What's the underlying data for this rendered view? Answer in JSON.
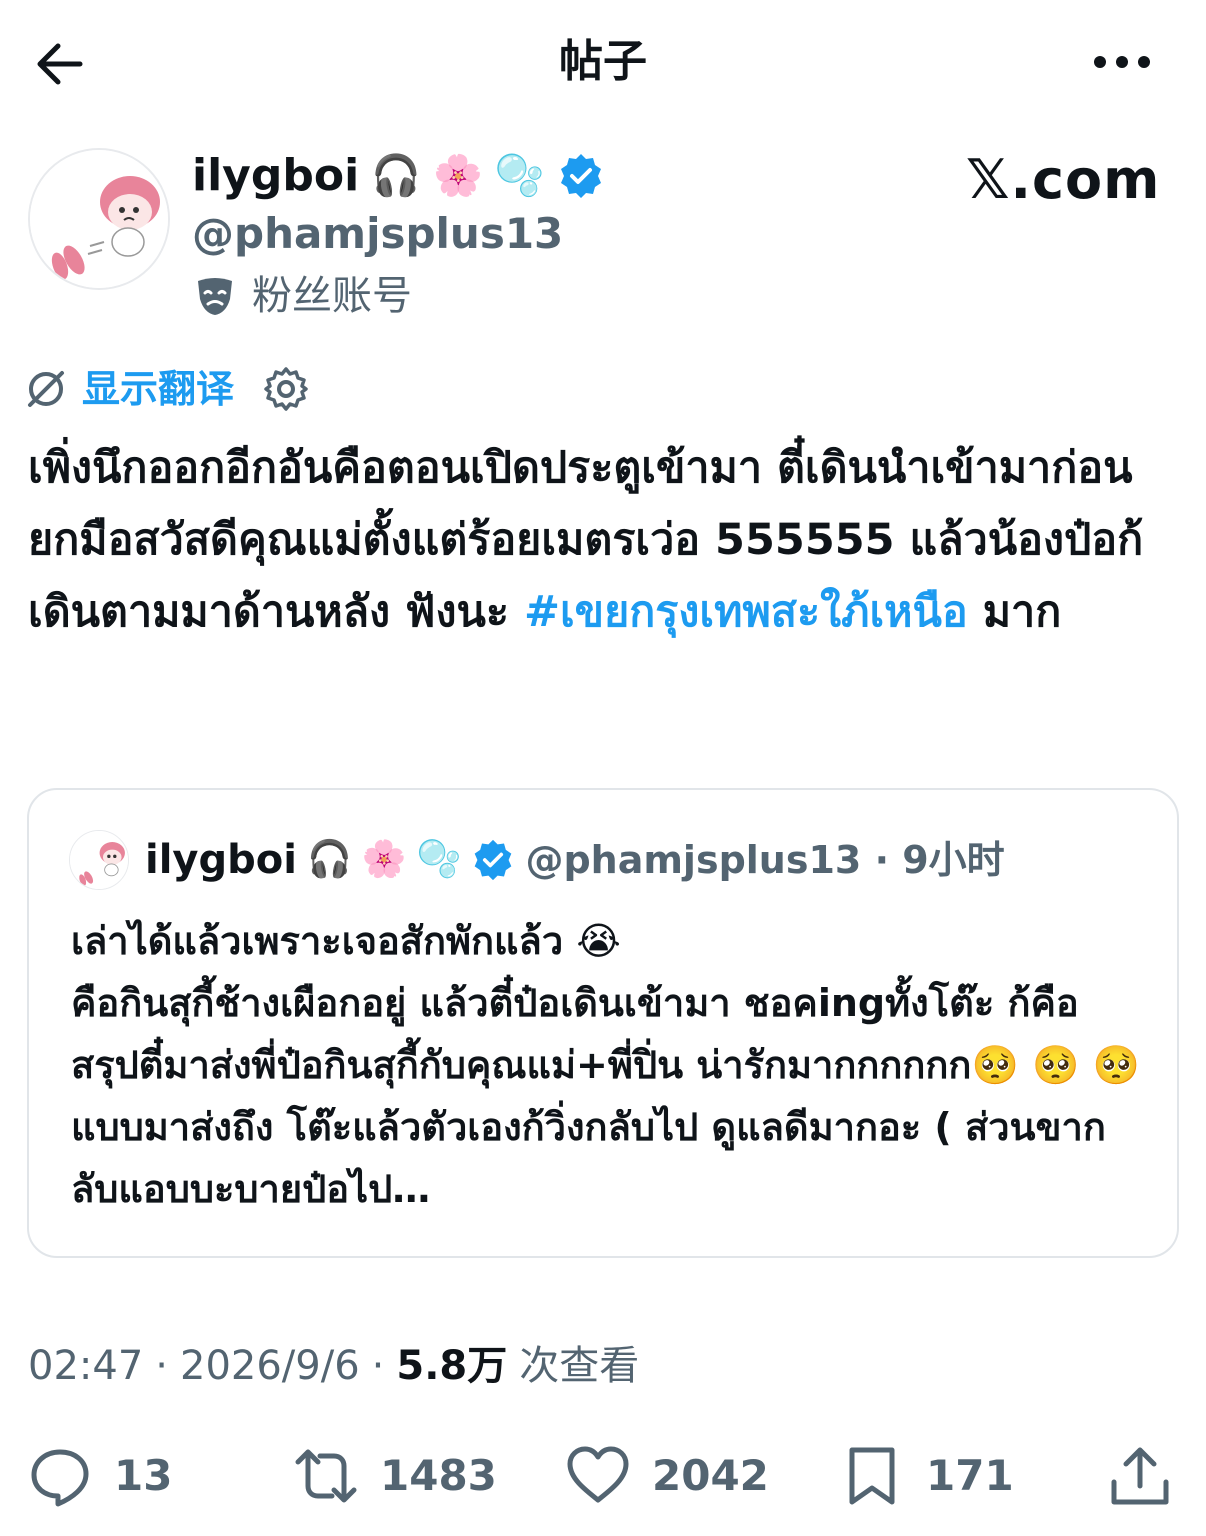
{
  "topbar": {
    "title": "帖子",
    "back_icon": "arrow-left-icon",
    "more_icon": "more-horizontal-icon"
  },
  "author": {
    "name": "ilygboi",
    "emojis": [
      "🎧",
      "🌸",
      "🫧"
    ],
    "handle": "@phamjsplus13",
    "fan_label": "粉丝账号",
    "brand": "𝕏.com",
    "verified_color": "#1d9bf0"
  },
  "translate": {
    "label": "显示翻译"
  },
  "tweet": {
    "text_main": "เพิ่งนึกออกอีกอันคือตอนเปิดประตูเข้ามา ตี๋เดินนำเข้ามาก่อน ยกมือสวัสดีคุณแม่ตั้งแต่ร้อยเมตรเว่อ 555555 แล้วน้องป๋อก้เดินตามมาด้านหลัง ฟังนะ ",
    "hashtag": "#เขยกรุงเทพสะใภ้เหนือ",
    "text_tail": " มาก"
  },
  "quote": {
    "name": "ilygboi",
    "emojis": [
      "🎧",
      "🌸",
      "🫧"
    ],
    "handle_time": "@phamjsplus13 · 9小时",
    "text": "เล่าได้แล้วเพราะเจอสักพักแล้ว 😭\nคือกินสุกี้ช้างเผือกอยู่ แล้วตี๋ป๋อเดินเข้ามา ชอคingทั้งโต๊ะ ก้คือสรุปตี๋มาส่งพี่ป๋อกินสุกี้กับคุณแม่+พี่ปิ่น น่ารักมากกกกกก🥺 🥺 🥺 แบบมาส่งถึง โต๊ะแล้วตัวเองก้วิ่งกลับไป ดูแลดีมากอะ ( ส่วนขากลับแอบบะบายป๋อไป…"
  },
  "meta": {
    "time": "02:47",
    "date": "2026/9/6",
    "views": "5.8万",
    "views_label": "次查看"
  },
  "actions": {
    "replies": "13",
    "reposts": "1483",
    "likes": "2042",
    "bookmarks": "171"
  }
}
